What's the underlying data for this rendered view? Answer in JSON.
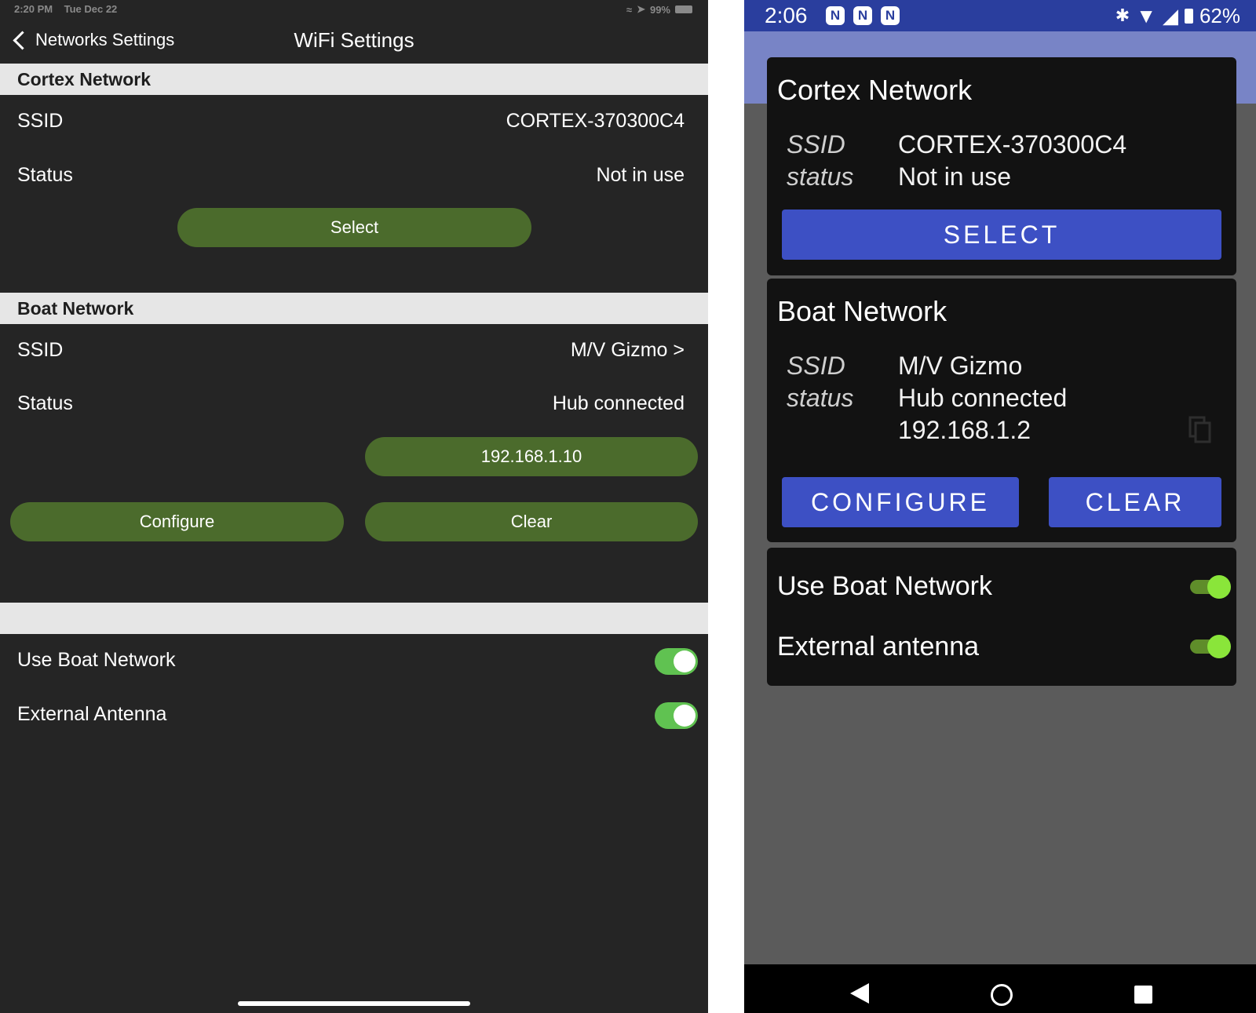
{
  "ios": {
    "status": {
      "time": "2:20 PM",
      "date": "Tue Dec 22",
      "battery": "99%"
    },
    "nav": {
      "back_label": "Networks Settings",
      "title": "WiFi Settings"
    },
    "cortex": {
      "header": "Cortex Network",
      "ssid_label": "SSID",
      "ssid_value": "CORTEX-370300C4",
      "status_label": "Status",
      "status_value": "Not in use",
      "select_label": "Select"
    },
    "boat": {
      "header": "Boat Network",
      "ssid_label": "SSID",
      "ssid_value": "M/V Gizmo >",
      "status_label": "Status",
      "status_value": "Hub connected",
      "ip_label": "192.168.1.10",
      "configure_label": "Configure",
      "clear_label": "Clear"
    },
    "toggles": {
      "use_boat_label": "Use Boat Network",
      "use_boat_on": true,
      "ext_antenna_label": "External Antenna",
      "ext_antenna_on": true
    }
  },
  "android": {
    "status": {
      "time": "2:06",
      "battery": "62%"
    },
    "cortex": {
      "title": "Cortex Network",
      "ssid_label": "SSID",
      "ssid_value": "CORTEX-370300C4",
      "status_label": "status",
      "status_value": "Not in use",
      "select_label": "SELECT"
    },
    "boat": {
      "title": "Boat Network",
      "ssid_label": "SSID",
      "ssid_value": "M/V Gizmo",
      "status_label": "status",
      "status_value": "Hub connected",
      "ip_value": "192.168.1.2",
      "configure_label": "CONFIGURE",
      "clear_label": "CLEAR"
    },
    "toggles": {
      "use_boat_label": "Use Boat Network",
      "use_boat_on": true,
      "ext_antenna_label": "External antenna",
      "ext_antenna_on": true
    }
  },
  "colors": {
    "ios_bg": "#252525",
    "ios_header": "#e6e6e6",
    "ios_button": "#4b6b2c",
    "ios_switch": "#60c251",
    "android_bg": "#5b5b5b",
    "android_statusbar": "#2a3e9e",
    "android_button": "#3d50c4",
    "android_card": "#121212",
    "android_switch": "#8ae53a"
  },
  "icons": [
    "chevron-left-icon",
    "wifi-icon",
    "location-icon",
    "battery-icon",
    "bluetooth-icon",
    "signal-icon",
    "copy-icon",
    "nav-back-icon",
    "nav-home-icon",
    "nav-recent-icon"
  ]
}
